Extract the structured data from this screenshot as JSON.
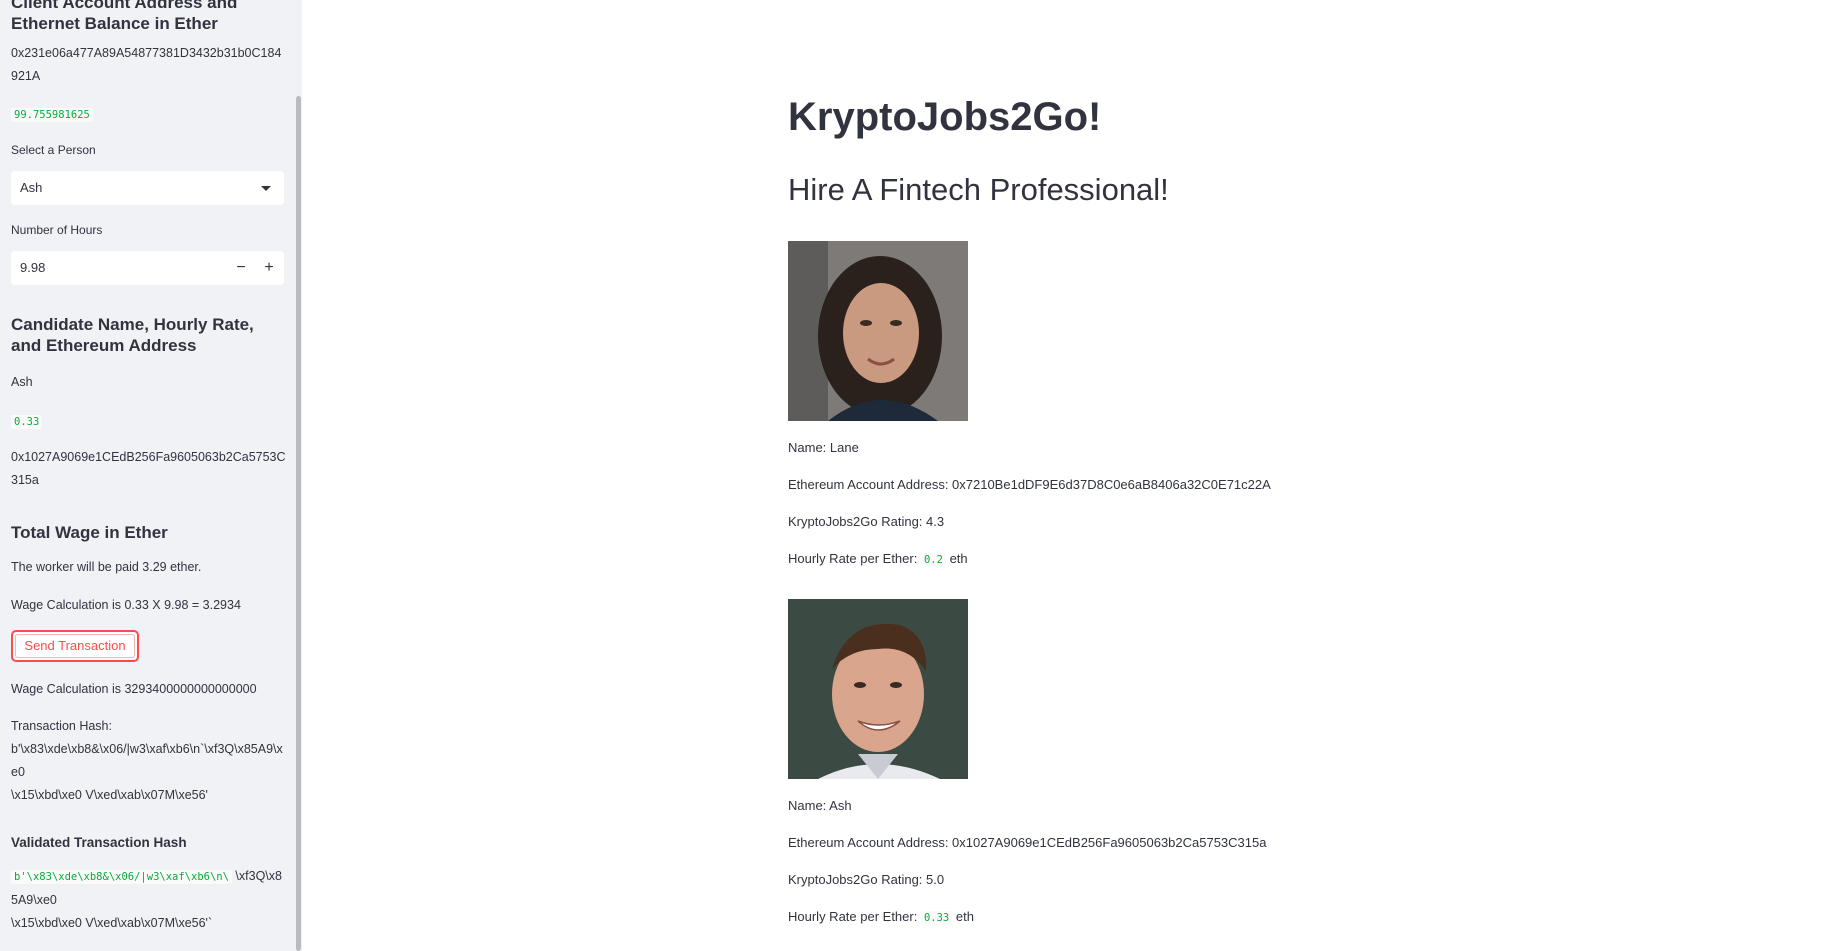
{
  "sidebar": {
    "client_header": "Client Account Address and Ethernet Balance in Ether",
    "client_address": "0x231e06a477A89A54877381D3432b31b0C184921A",
    "client_balance": "99.755981625",
    "select_person_label": "Select a Person",
    "select_person_value": "Ash",
    "hours_label": "Number of Hours",
    "hours_value": "9.98",
    "hours_minus": "−",
    "hours_plus": "+",
    "candidate_header": "Candidate Name, Hourly Rate, and Ethereum Address",
    "candidate_name": "Ash",
    "candidate_rate": "0.33",
    "candidate_address": "0x1027A9069e1CEdB256Fa9605063b2Ca5753C315a",
    "wage_header": "Total Wage in Ether",
    "wage_paid": "The worker will be paid 3.29 ether.",
    "wage_calc": "Wage Calculation is 0.33 X 9.98 = 3.2934",
    "send_button": "Send Transaction",
    "wage_calc_wei": "Wage Calculation is 3293400000000000000",
    "tx_hash_label": "Transaction Hash:",
    "tx_hash_value": "b'\\x83\\xde\\xb8&\\x06/|w3\\xaf\\xb6\\n`\\xf3Q\\x85A9\\xe0\n\\x15\\xbd\\xe0 V\\xed\\xab\\x07M\\xe56'",
    "validated_header": "Validated Transaction Hash",
    "validated_code": "b'\\x83\\xde\\xb8&\\x06/|w3\\xaf\\xb6\\n\\",
    "validated_rest": "\\xf3Q\\x85A9\\xe0\n\\x15\\xbd\\xe0 V\\xed\\xab\\x07M\\xe56'`"
  },
  "main": {
    "title": "KryptoJobs2Go!",
    "subtitle": "Hire A Fintech Professional!",
    "candidates": [
      {
        "name_line": "Name: Lane",
        "address_line": "Ethereum Account Address: 0x7210Be1dDF9E6d37D8C0e6aB8406a32C0E71c22A",
        "rating_line": "KryptoJobs2Go Rating: 4.3",
        "rate_label": "Hourly Rate per Ether:",
        "rate_value": "0.2",
        "rate_unit": "eth"
      },
      {
        "name_line": "Name: Ash",
        "address_line": "Ethereum Account Address: 0x1027A9069e1CEdB256Fa9605063b2Ca5753C315a",
        "rating_line": "KryptoJobs2Go Rating: 5.0",
        "rate_label": "Hourly Rate per Ether:",
        "rate_value": "0.33",
        "rate_unit": "eth"
      }
    ]
  },
  "colors": {
    "sidebar_bg": "#f0f2f6",
    "text": "#31333f",
    "code_green": "#09ab3b",
    "button_red": "#ff4b4b"
  }
}
